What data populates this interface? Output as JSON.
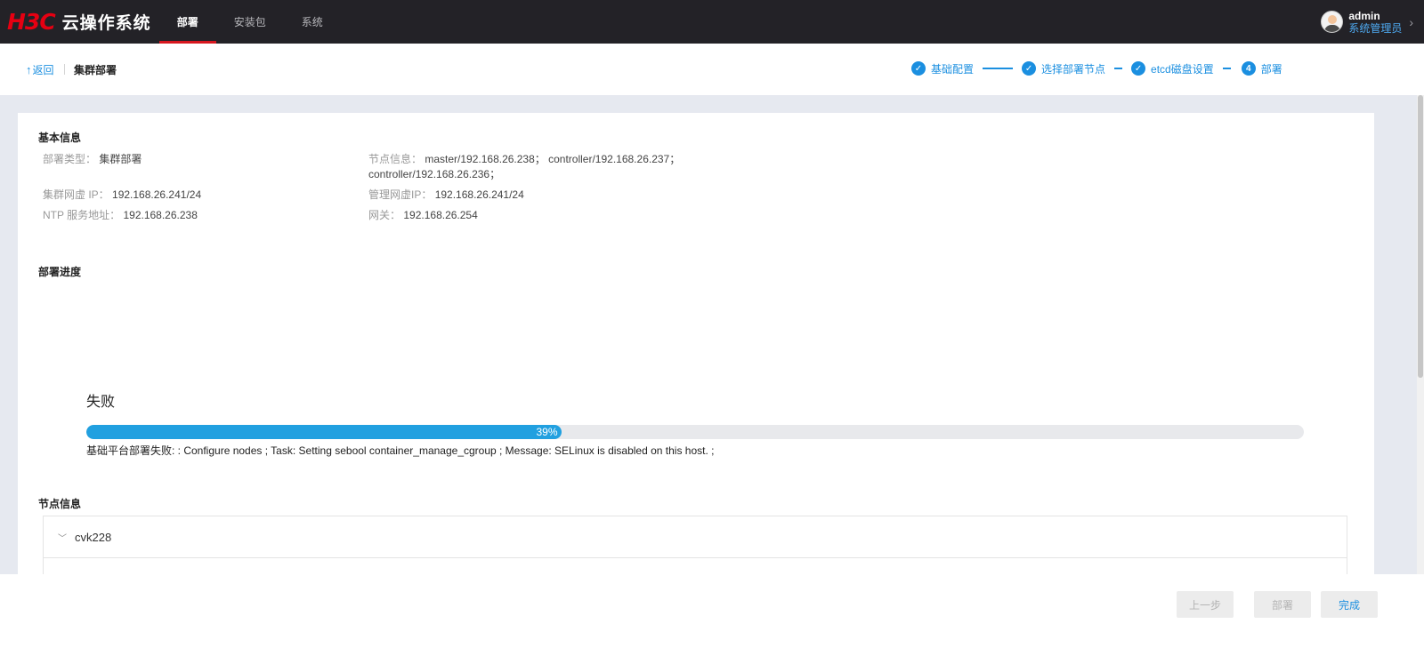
{
  "nav": {
    "logo": "H3C",
    "title": "云操作系统",
    "tabs": [
      {
        "label": "部署"
      },
      {
        "label": "安装包"
      },
      {
        "label": "系统"
      }
    ]
  },
  "user": {
    "name": "admin",
    "role": "系统管理员"
  },
  "subheader": {
    "back_label": "返回",
    "page_title": "集群部署"
  },
  "steps": [
    {
      "label": "基础配置",
      "marker": "✓"
    },
    {
      "label": "选择部署节点",
      "marker": "✓"
    },
    {
      "label": "etcd磁盘设置",
      "marker": "✓"
    },
    {
      "label": "部署",
      "marker": "4"
    }
  ],
  "basic_info": {
    "title": "基本信息",
    "deploy_type_label": "部署类型：",
    "deploy_type_value": "集群部署",
    "cluster_vip_label": "集群网虚 IP：",
    "cluster_vip_value": "192.168.26.241/24",
    "ntp_label": "NTP 服务地址：",
    "ntp_value": "192.168.26.238",
    "nodes_label": "节点信息：",
    "nodes_value_line1": "master/192.168.26.238； controller/192.168.26.237；",
    "nodes_value_line2": "controller/192.168.26.236；",
    "mgmt_vip_label": "管理网虚IP：",
    "mgmt_vip_value": "192.168.26.241/24",
    "gateway_label": "网关：",
    "gateway_value": "192.168.26.254"
  },
  "progress": {
    "title": "部署进度",
    "status": "失败",
    "percent": 39,
    "percent_label": "39%",
    "message": "基础平台部署失败: : Configure nodes ; Task: Setting sebool container_manage_cgroup ; Message: SELinux is disabled on this host. ;"
  },
  "nodes": {
    "title": "节点信息",
    "items": [
      {
        "name": "cvk228"
      }
    ]
  },
  "footer": {
    "prev_label": "上一步",
    "deploy_label": "部署",
    "finish_label": "完成"
  },
  "colors": {
    "accent": "#1b8fe0",
    "progress": "#21a0e0",
    "brand_red": "#e60012",
    "nav_bg": "#232227"
  }
}
